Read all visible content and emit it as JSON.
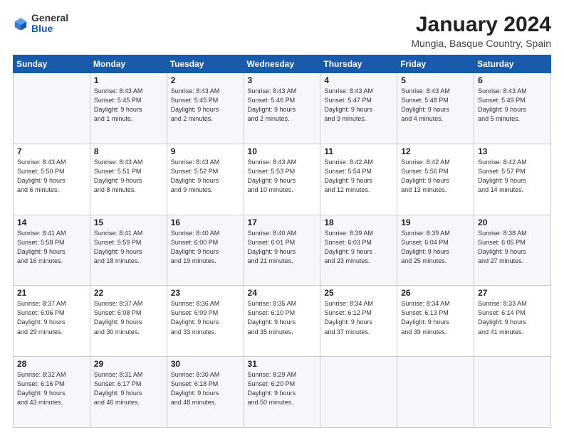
{
  "header": {
    "logo_general": "General",
    "logo_blue": "Blue",
    "title": "January 2024",
    "subtitle": "Mungia, Basque Country, Spain"
  },
  "calendar": {
    "days_of_week": [
      "Sunday",
      "Monday",
      "Tuesday",
      "Wednesday",
      "Thursday",
      "Friday",
      "Saturday"
    ],
    "weeks": [
      [
        {
          "day": "",
          "info": ""
        },
        {
          "day": "1",
          "info": "Sunrise: 8:43 AM\nSunset: 5:45 PM\nDaylight: 9 hours\nand 1 minute."
        },
        {
          "day": "2",
          "info": "Sunrise: 8:43 AM\nSunset: 5:45 PM\nDaylight: 9 hours\nand 2 minutes."
        },
        {
          "day": "3",
          "info": "Sunrise: 8:43 AM\nSunset: 5:46 PM\nDaylight: 9 hours\nand 2 minutes."
        },
        {
          "day": "4",
          "info": "Sunrise: 8:43 AM\nSunset: 5:47 PM\nDaylight: 9 hours\nand 3 minutes."
        },
        {
          "day": "5",
          "info": "Sunrise: 8:43 AM\nSunset: 5:48 PM\nDaylight: 9 hours\nand 4 minutes."
        },
        {
          "day": "6",
          "info": "Sunrise: 8:43 AM\nSunset: 5:49 PM\nDaylight: 9 hours\nand 5 minutes."
        }
      ],
      [
        {
          "day": "7",
          "info": "Sunrise: 8:43 AM\nSunset: 5:50 PM\nDaylight: 9 hours\nand 6 minutes."
        },
        {
          "day": "8",
          "info": "Sunrise: 8:43 AM\nSunset: 5:51 PM\nDaylight: 9 hours\nand 8 minutes."
        },
        {
          "day": "9",
          "info": "Sunrise: 8:43 AM\nSunset: 5:52 PM\nDaylight: 9 hours\nand 9 minutes."
        },
        {
          "day": "10",
          "info": "Sunrise: 8:43 AM\nSunset: 5:53 PM\nDaylight: 9 hours\nand 10 minutes."
        },
        {
          "day": "11",
          "info": "Sunrise: 8:42 AM\nSunset: 5:54 PM\nDaylight: 9 hours\nand 12 minutes."
        },
        {
          "day": "12",
          "info": "Sunrise: 8:42 AM\nSunset: 5:56 PM\nDaylight: 9 hours\nand 13 minutes."
        },
        {
          "day": "13",
          "info": "Sunrise: 8:42 AM\nSunset: 5:57 PM\nDaylight: 9 hours\nand 14 minutes."
        }
      ],
      [
        {
          "day": "14",
          "info": "Sunrise: 8:41 AM\nSunset: 5:58 PM\nDaylight: 9 hours\nand 16 minutes."
        },
        {
          "day": "15",
          "info": "Sunrise: 8:41 AM\nSunset: 5:59 PM\nDaylight: 9 hours\nand 18 minutes."
        },
        {
          "day": "16",
          "info": "Sunrise: 8:40 AM\nSunset: 6:00 PM\nDaylight: 9 hours\nand 19 minutes."
        },
        {
          "day": "17",
          "info": "Sunrise: 8:40 AM\nSunset: 6:01 PM\nDaylight: 9 hours\nand 21 minutes."
        },
        {
          "day": "18",
          "info": "Sunrise: 8:39 AM\nSunset: 6:03 PM\nDaylight: 9 hours\nand 23 minutes."
        },
        {
          "day": "19",
          "info": "Sunrise: 8:39 AM\nSunset: 6:04 PM\nDaylight: 9 hours\nand 25 minutes."
        },
        {
          "day": "20",
          "info": "Sunrise: 8:38 AM\nSunset: 6:05 PM\nDaylight: 9 hours\nand 27 minutes."
        }
      ],
      [
        {
          "day": "21",
          "info": "Sunrise: 8:37 AM\nSunset: 6:06 PM\nDaylight: 9 hours\nand 29 minutes."
        },
        {
          "day": "22",
          "info": "Sunrise: 8:37 AM\nSunset: 6:08 PM\nDaylight: 9 hours\nand 30 minutes."
        },
        {
          "day": "23",
          "info": "Sunrise: 8:36 AM\nSunset: 6:09 PM\nDaylight: 9 hours\nand 33 minutes."
        },
        {
          "day": "24",
          "info": "Sunrise: 8:35 AM\nSunset: 6:10 PM\nDaylight: 9 hours\nand 35 minutes."
        },
        {
          "day": "25",
          "info": "Sunrise: 8:34 AM\nSunset: 6:12 PM\nDaylight: 9 hours\nand 37 minutes."
        },
        {
          "day": "26",
          "info": "Sunrise: 8:34 AM\nSunset: 6:13 PM\nDaylight: 9 hours\nand 39 minutes."
        },
        {
          "day": "27",
          "info": "Sunrise: 8:33 AM\nSunset: 6:14 PM\nDaylight: 9 hours\nand 41 minutes."
        }
      ],
      [
        {
          "day": "28",
          "info": "Sunrise: 8:32 AM\nSunset: 6:16 PM\nDaylight: 9 hours\nand 43 minutes."
        },
        {
          "day": "29",
          "info": "Sunrise: 8:31 AM\nSunset: 6:17 PM\nDaylight: 9 hours\nand 46 minutes."
        },
        {
          "day": "30",
          "info": "Sunrise: 8:30 AM\nSunset: 6:18 PM\nDaylight: 9 hours\nand 48 minutes."
        },
        {
          "day": "31",
          "info": "Sunrise: 8:29 AM\nSunset: 6:20 PM\nDaylight: 9 hours\nand 50 minutes."
        },
        {
          "day": "",
          "info": ""
        },
        {
          "day": "",
          "info": ""
        },
        {
          "day": "",
          "info": ""
        }
      ]
    ]
  }
}
